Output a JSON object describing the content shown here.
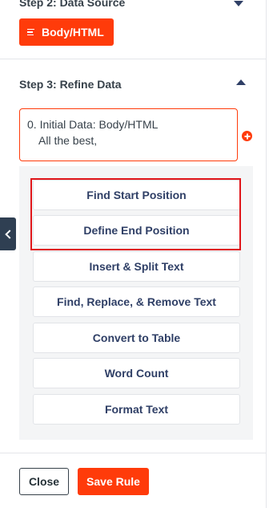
{
  "step2": {
    "title": "Step 2: Data Source",
    "source_button": "Body/HTML",
    "source_icon": "lines-icon"
  },
  "step3": {
    "title": "Step 3: Refine Data",
    "initial": {
      "label": "0. Initial Data: Body/HTML",
      "preview": "All the best,"
    },
    "actions": [
      {
        "label": "Find Start Position"
      },
      {
        "label": "Define End Position"
      },
      {
        "label": "Insert & Split Text"
      },
      {
        "label": "Find, Replace, & Remove Text"
      },
      {
        "label": "Convert to Table"
      },
      {
        "label": "Word Count"
      },
      {
        "label": "Format Text"
      }
    ]
  },
  "footer": {
    "close_label": "Close",
    "save_label": "Save Rule"
  },
  "colors": {
    "accent": "#ff3b0a",
    "navy": "#2f3f66",
    "highlight": "#e0161a"
  }
}
